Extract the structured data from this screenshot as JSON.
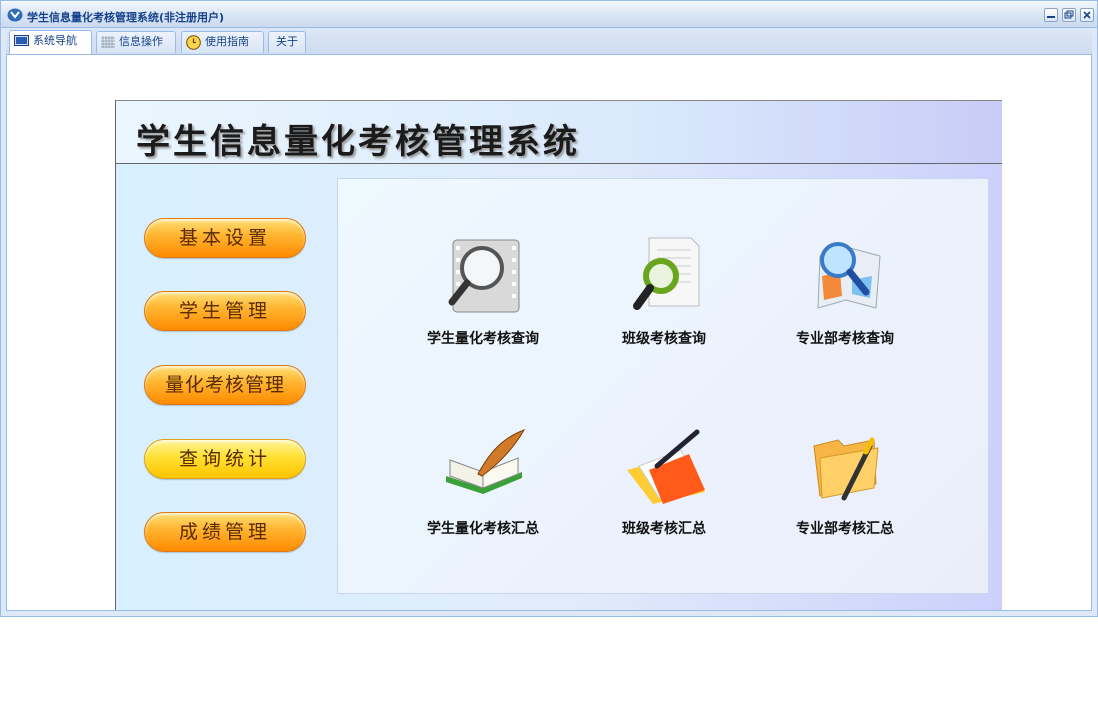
{
  "window": {
    "title": "学生信息量化考核管理系统(非注册用户)",
    "controls": [
      "minimize-icon",
      "restore-icon",
      "close-icon"
    ]
  },
  "tabs": [
    {
      "label": "系统导航",
      "icon": "monitor-icon",
      "active": true
    },
    {
      "label": "信息操作",
      "icon": "grid-icon",
      "active": false
    },
    {
      "label": "使用指南",
      "icon": "clock-icon",
      "active": false
    },
    {
      "label": "关于",
      "icon": "",
      "active": false
    }
  ],
  "header": {
    "title": "学生信息量化考核管理系统"
  },
  "menu": [
    {
      "label": "基本设置"
    },
    {
      "label": "学生管理"
    },
    {
      "label": "量化考核管理"
    },
    {
      "label": "查询统计"
    },
    {
      "label": "成绩管理"
    }
  ],
  "items": [
    {
      "label": "学生量化考核查询",
      "icon": "film-magnifier-icon"
    },
    {
      "label": "班级考核查询",
      "icon": "document-search-icon"
    },
    {
      "label": "专业部考核查询",
      "icon": "map-search-icon"
    },
    {
      "label": "学生量化考核汇总",
      "icon": "book-quill-icon"
    },
    {
      "label": "班级考核汇总",
      "icon": "folder-pen-icon"
    },
    {
      "label": "专业部考核汇总",
      "icon": "folder-pencil-icon"
    }
  ],
  "colors": {
    "window_border": "#99bbe8",
    "title_text": "#15428b",
    "button_orange": "#ff9a10",
    "button_yellow": "#ffe033"
  }
}
